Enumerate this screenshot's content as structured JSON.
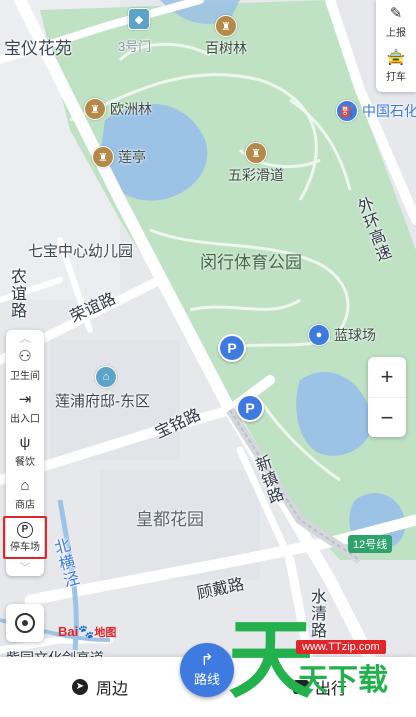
{
  "colors": {
    "park": "#bfe1c4",
    "water": "#9cc3e6",
    "road": "#ffffff",
    "urban": "#e6e8ec",
    "accent_blue": "#3f7ae0",
    "metro_green": "#2ea36b",
    "poi_brown": "#b48a4a",
    "highlight_red": "#e0262a"
  },
  "map": {
    "places": {
      "baoyi_garden": "宝仪花苑",
      "exit3": "3号门",
      "baishu_forest": "百树林",
      "europe_forest": "欧洲林",
      "lotus_pavilion": "莲亭",
      "colorful_slide": "五彩滑道",
      "kindergarten": "七宝中心幼儿园",
      "park_name": "闵行体育公园",
      "basketball": "蓝球场",
      "lianpu_mansion": "莲浦府邸-东区",
      "huangdu_garden": "皇都花园",
      "sinopec": "中国石化"
    },
    "roads": {
      "nongyi": "农谊路",
      "rongyi": "荣谊路",
      "baoming": "宝铭路",
      "xinzhen": "新镇路",
      "guxi": "顾戴路",
      "shuiqing": "水清路",
      "beiheng": "北横泾",
      "outer_ring": "外环高速",
      "metro": "12号线",
      "bottom_road": "紫园文化剑高道"
    },
    "brand": {
      "baidu": "Bai",
      "du": "du",
      "map": "地图"
    }
  },
  "right_tools": [
    {
      "icon": "report-icon",
      "label": "上报"
    },
    {
      "icon": "taxi-icon",
      "label": "打车"
    }
  ],
  "categories": [
    {
      "icon": "restroom-icon",
      "label": "卫生间"
    },
    {
      "icon": "entrance-icon",
      "label": "出入口"
    },
    {
      "icon": "dining-icon",
      "label": "餐饮"
    },
    {
      "icon": "shop-icon",
      "label": "商店"
    },
    {
      "icon": "parking-icon",
      "label": "停车场",
      "selected": true
    }
  ],
  "zoom": {
    "in": "+",
    "out": "−"
  },
  "bottom": {
    "around": "周边",
    "route": "路线",
    "go": "出行"
  },
  "watermark": {
    "big": "天",
    "small": "天下载",
    "url": "www.TTzip.com"
  }
}
